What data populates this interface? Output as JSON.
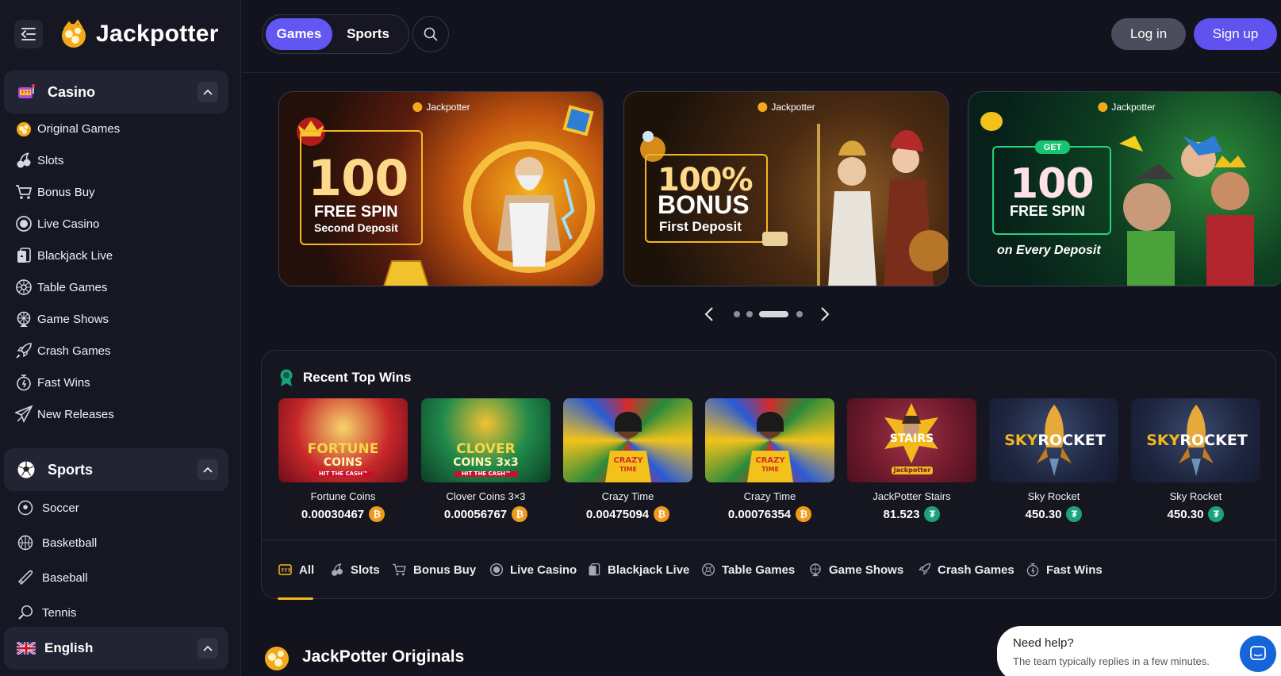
{
  "brand": {
    "name": "Jackpotter"
  },
  "header": {
    "games_label": "Games",
    "sports_label": "Sports",
    "login_label": "Log in",
    "signup_label": "Sign up"
  },
  "sidebar": {
    "casino": {
      "label": "Casino",
      "items": [
        {
          "label": "Original Games",
          "icon": "jackpotter-icon"
        },
        {
          "label": "Slots",
          "icon": "cherry-icon"
        },
        {
          "label": "Bonus Buy",
          "icon": "cart-icon"
        },
        {
          "label": "Live Casino",
          "icon": "live-icon"
        },
        {
          "label": "Blackjack Live",
          "icon": "cards-icon"
        },
        {
          "label": "Table Games",
          "icon": "roulette-icon"
        },
        {
          "label": "Game Shows",
          "icon": "wheel-icon"
        },
        {
          "label": "Crash Games",
          "icon": "rocket-icon"
        },
        {
          "label": "Fast Wins",
          "icon": "stopwatch-icon"
        },
        {
          "label": "New Releases",
          "icon": "paper-plane-icon"
        }
      ]
    },
    "sports": {
      "label": "Sports",
      "items": [
        {
          "label": "Soccer",
          "icon": "soccer-ball-icon"
        },
        {
          "label": "Basketball",
          "icon": "basketball-icon"
        },
        {
          "label": "Baseball",
          "icon": "baseball-bat-icon"
        },
        {
          "label": "Tennis",
          "icon": "tennis-icon"
        }
      ]
    },
    "language": {
      "label": "English",
      "icon": "uk-flag-icon"
    }
  },
  "banners": [
    {
      "brand": "Jackpotter",
      "big": "100",
      "line1": "FREE SPIN",
      "line2": "Second Deposit"
    },
    {
      "brand": "Jackpotter",
      "big": "100%",
      "line1": "BONUS",
      "line2": "First Deposit"
    },
    {
      "brand": "Jackpotter",
      "tag": "GET",
      "big": "100",
      "line1": "FREE SPIN",
      "line2": "on Every Deposit"
    }
  ],
  "carousel": {
    "active_index": 2,
    "count": 4
  },
  "recent_wins": {
    "title": "Recent Top Wins",
    "items": [
      {
        "game": "Fortune Coins",
        "amount": "0.00030467",
        "currency": "BTC",
        "art": [
          "FORTUNE",
          "COINS",
          "HIT THE CASH™"
        ]
      },
      {
        "game": "Clover Coins 3×3",
        "amount": "0.00056767",
        "currency": "BTC",
        "art": [
          "CLOVER",
          "COINS 3x3",
          "HIT THE CASH™"
        ]
      },
      {
        "game": "Crazy Time",
        "amount": "0.00475094",
        "currency": "BTC",
        "art": [
          "CRAZY",
          "TIME"
        ]
      },
      {
        "game": "Crazy Time",
        "amount": "0.00076354",
        "currency": "BTC",
        "art": [
          "CRAZY",
          "TIME"
        ]
      },
      {
        "game": "JackPotter Stairs",
        "amount": "81.523",
        "currency": "USDT",
        "art": [
          "STAIRS",
          "Jackpotter"
        ]
      },
      {
        "game": "Sky Rocket",
        "amount": "450.30",
        "currency": "USDT",
        "art": [
          "SKY",
          "ROCKET"
        ]
      },
      {
        "game": "Sky Rocket",
        "amount": "450.30",
        "currency": "USDT",
        "art": [
          "SKY",
          "ROCKET"
        ]
      }
    ]
  },
  "categories": [
    {
      "label": "All",
      "icon": "slot-777-icon",
      "active": true
    },
    {
      "label": "Slots",
      "icon": "cherry-icon"
    },
    {
      "label": "Bonus Buy",
      "icon": "cart-icon"
    },
    {
      "label": "Live Casino",
      "icon": "live-icon"
    },
    {
      "label": "Blackjack Live",
      "icon": "cards-icon"
    },
    {
      "label": "Table Games",
      "icon": "roulette-icon"
    },
    {
      "label": "Game Shows",
      "icon": "wheel-icon"
    },
    {
      "label": "Crash Games",
      "icon": "rocket-icon"
    },
    {
      "label": "Fast Wins",
      "icon": "stopwatch-icon"
    }
  ],
  "originals": {
    "title": "JackPotter Originals"
  },
  "help": {
    "title": "Need help?",
    "subtitle": "The team typically replies in a few minutes."
  },
  "colors": {
    "accent": "#6257f2",
    "gold": "#f2b81e",
    "btc": "#f09a1a",
    "usdt": "#1aa37a",
    "bg": "#12131c"
  }
}
